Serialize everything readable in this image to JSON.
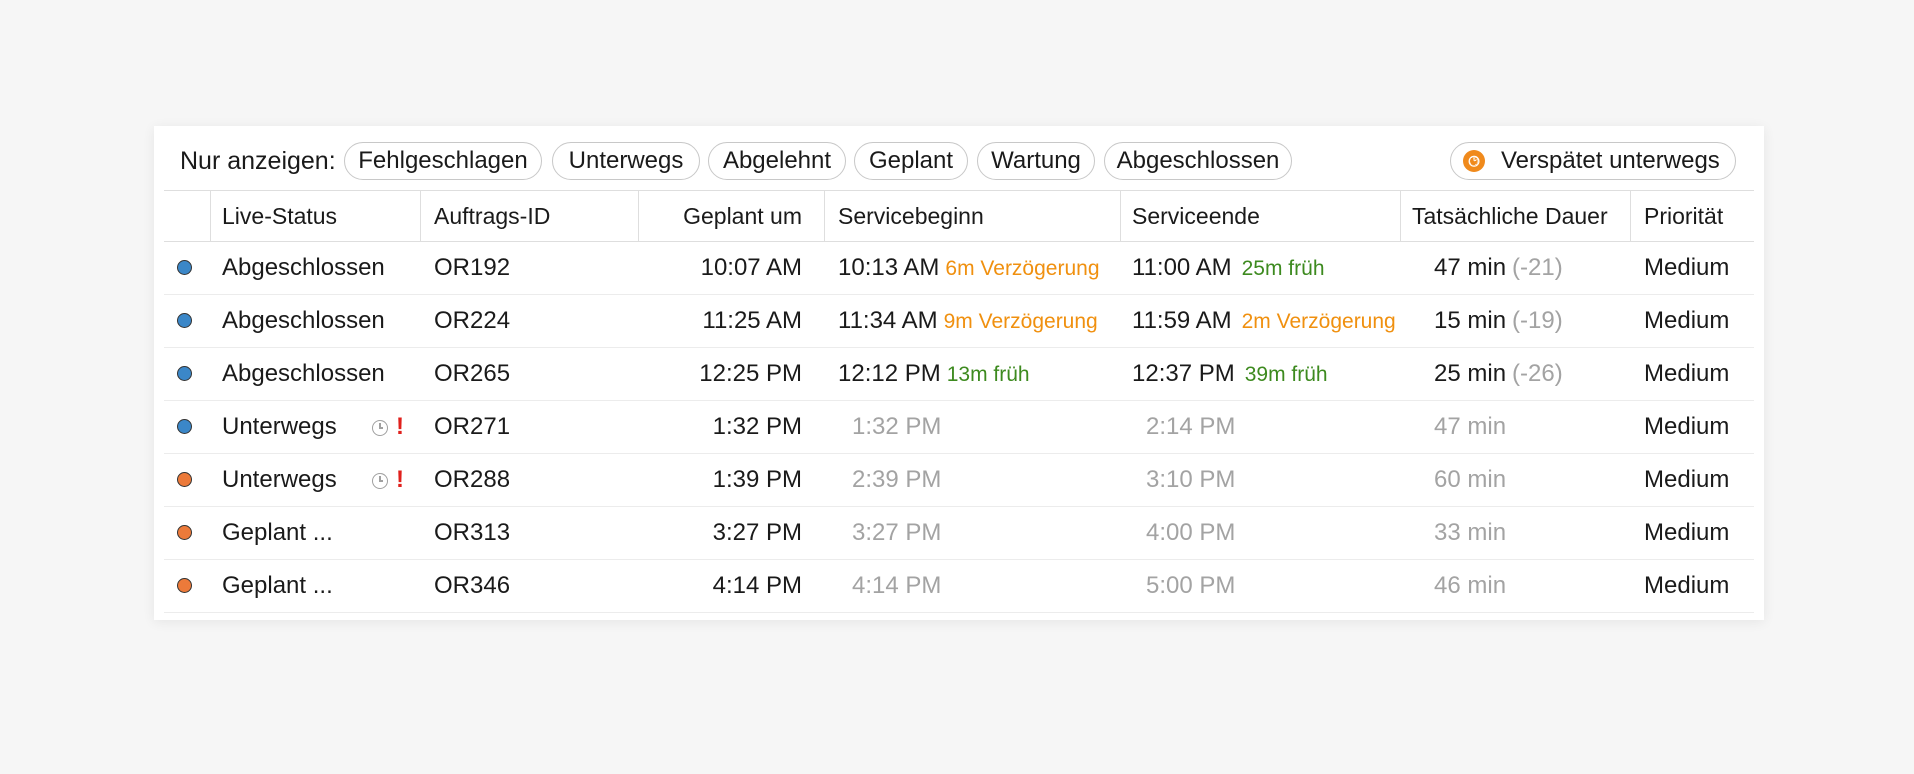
{
  "filters": {
    "label": "Nur anzeigen:",
    "chips": [
      "Fehlgeschlagen",
      "Unterwegs",
      "Abgelehnt",
      "Geplant",
      "Wartung",
      "Abgeschlossen"
    ],
    "late_chip": "Verspätet unterwegs",
    "late_icon": "clock-icon",
    "late_color": "#f08a1c"
  },
  "columns": [
    "Live-Status",
    "Auftrags-ID",
    "Geplant um",
    "Servicebeginn",
    "Serviceende",
    "Tatsächliche Dauer",
    "Priorität"
  ],
  "colors": {
    "blue_status": "#3b87c8",
    "orange_status": "#ec7a3a",
    "delay": "#f0900f",
    "early": "#3d8a1f"
  },
  "rows": [
    {
      "status_color": "#3b87c8",
      "status": "Abgeschlossen",
      "id": "OR192",
      "planned": "10:07 AM",
      "start": "10:13 AM",
      "start_note": "6m Verzögerung",
      "start_note_type": "delay",
      "end": "11:00 AM",
      "end_note": "25m früh",
      "end_note_type": "early",
      "duration": "47 min",
      "duration_diff": "(-21)",
      "priority": "Medium",
      "icons": false,
      "actual": true
    },
    {
      "status_color": "#3b87c8",
      "status": "Abgeschlossen",
      "id": "OR224",
      "planned": "11:25 AM",
      "start": "11:34 AM",
      "start_note": "9m Verzögerung",
      "start_note_type": "delay",
      "end": "11:59 AM",
      "end_note": "2m Verzögerung",
      "end_note_type": "delay",
      "duration": "15 min",
      "duration_diff": "(-19)",
      "priority": "Medium",
      "icons": false,
      "actual": true
    },
    {
      "status_color": "#3b87c8",
      "status": "Abgeschlossen",
      "id": "OR265",
      "planned": "12:25 PM",
      "start": "12:12 PM",
      "start_note": "13m früh",
      "start_note_type": "early",
      "end": "12:37 PM",
      "end_note": "39m früh",
      "end_note_type": "early",
      "duration": "25 min",
      "duration_diff": "(-26)",
      "priority": "Medium",
      "icons": false,
      "actual": true
    },
    {
      "status_color": "#3b87c8",
      "status": "Unterwegs",
      "id": "OR271",
      "planned": "1:32 PM",
      "start": "1:32 PM",
      "start_note": "",
      "start_note_type": "",
      "end": "2:14 PM",
      "end_note": "",
      "end_note_type": "",
      "duration": "47 min",
      "duration_diff": "",
      "priority": "Medium",
      "icons": true,
      "actual": false
    },
    {
      "status_color": "#ec7a3a",
      "status": "Unterwegs",
      "id": "OR288",
      "planned": "1:39 PM",
      "start": "2:39 PM",
      "start_note": "",
      "start_note_type": "",
      "end": "3:10 PM",
      "end_note": "",
      "end_note_type": "",
      "duration": "60 min",
      "duration_diff": "",
      "priority": "Medium",
      "icons": true,
      "actual": false
    },
    {
      "status_color": "#ec7a3a",
      "status": "Geplant ...",
      "id": "OR313",
      "planned": "3:27 PM",
      "start": "3:27 PM",
      "start_note": "",
      "start_note_type": "",
      "end": "4:00 PM",
      "end_note": "",
      "end_note_type": "",
      "duration": "33 min",
      "duration_diff": "",
      "priority": "Medium",
      "icons": false,
      "actual": false
    },
    {
      "status_color": "#ec7a3a",
      "status": "Geplant ...",
      "id": "OR346",
      "planned": "4:14 PM",
      "start": "4:14 PM",
      "start_note": "",
      "start_note_type": "",
      "end": "5:00 PM",
      "end_note": "",
      "end_note_type": "",
      "duration": "46 min",
      "duration_diff": "",
      "priority": "Medium",
      "icons": false,
      "actual": false
    }
  ]
}
